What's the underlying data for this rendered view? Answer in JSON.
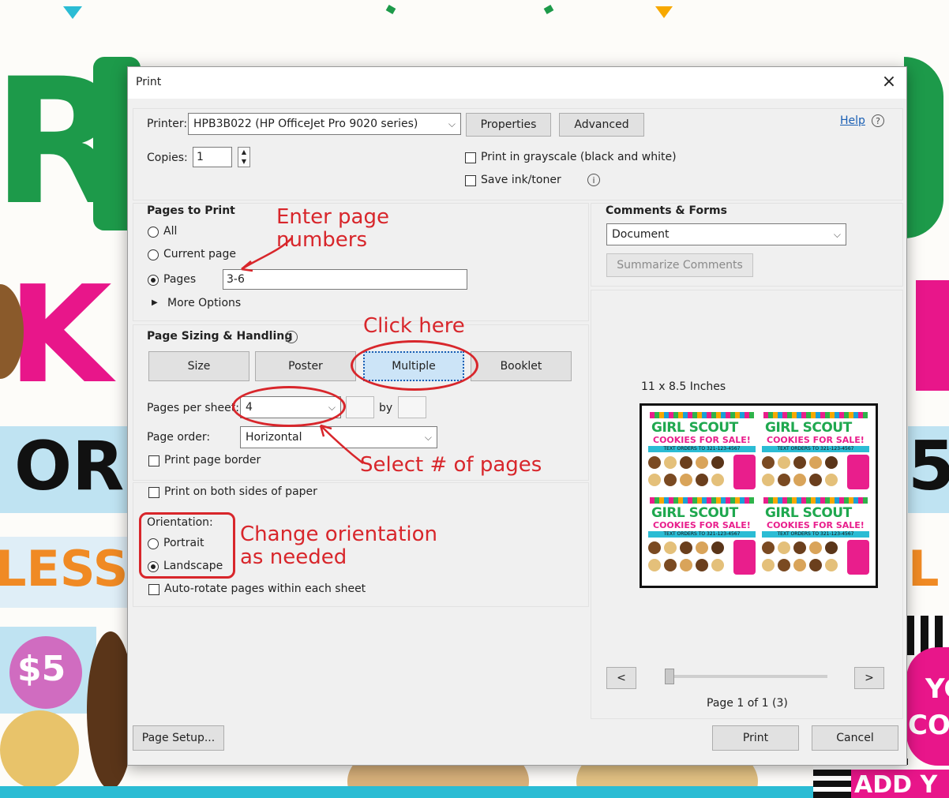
{
  "background": {
    "big_letters_top": "R",
    "big_letters_mid": "K",
    "band_left": "OR",
    "band_right": "5",
    "less": "LESS",
    "price": "$5",
    "right_text_l": "L",
    "badge_right_1": "YC",
    "badge_right_2": "CO",
    "bottom_right": "ADD Y"
  },
  "dialog": {
    "title": "Print",
    "close": "×",
    "printer_label": "Printer:",
    "printer_value": "HPB3B022 (HP OfficeJet Pro 9020 series)",
    "properties": "Properties",
    "advanced": "Advanced",
    "help": "Help",
    "help_icon": "?",
    "copies_label": "Copies:",
    "copies_value": "1",
    "grayscale": "Print in grayscale (black and white)",
    "save_ink": "Save ink/toner",
    "info_icon": "i",
    "pages_to_print": {
      "heading": "Pages to Print",
      "all": "All",
      "current": "Current page",
      "pages": "Pages",
      "pages_value": "3-6",
      "more_options": "More Options",
      "more_arrow": "▶"
    },
    "sizing": {
      "heading": "Page Sizing & Handling",
      "tabs": [
        "Size",
        "Poster",
        "Multiple",
        "Booklet"
      ],
      "pages_per_sheet_label": "Pages per sheet:",
      "pages_per_sheet_value": "4",
      "by": "by",
      "page_order_label": "Page order:",
      "page_order_value": "Horizontal",
      "print_border": "Print page border"
    },
    "both_sides": "Print on both sides of paper",
    "orientation": {
      "heading": "Orientation:",
      "portrait": "Portrait",
      "landscape": "Landscape"
    },
    "auto_rotate": "Auto-rotate pages within each sheet",
    "comments": {
      "heading": "Comments & Forms",
      "value": "Document",
      "summarize": "Summarize Comments"
    },
    "preview": {
      "size_label": "11 x 8.5 Inches",
      "prev": "<",
      "next": ">",
      "page_info": "Page 1 of 1 (3)",
      "slider_position": 0
    },
    "page_setup": "Page Setup...",
    "print": "Print",
    "cancel": "Cancel",
    "chevron": "⌵"
  },
  "mini_sheet": {
    "title1": "GIRL SCOUT",
    "title2": "COOKIES FOR SALE!",
    "title3": "TEXT ORDERS TO 321-123-4567"
  },
  "annotations": {
    "enter_pages": "Enter page\nnumbers",
    "click_here": "Click here",
    "select_pages": "Select # of pages",
    "change_orientation": "Change orientation\nas needed"
  },
  "colors": {
    "annotation_red": "#d8262b",
    "poster_green": "#1d9a4a",
    "poster_pink": "#e8168a",
    "poster_blue": "#bfe3f2"
  }
}
